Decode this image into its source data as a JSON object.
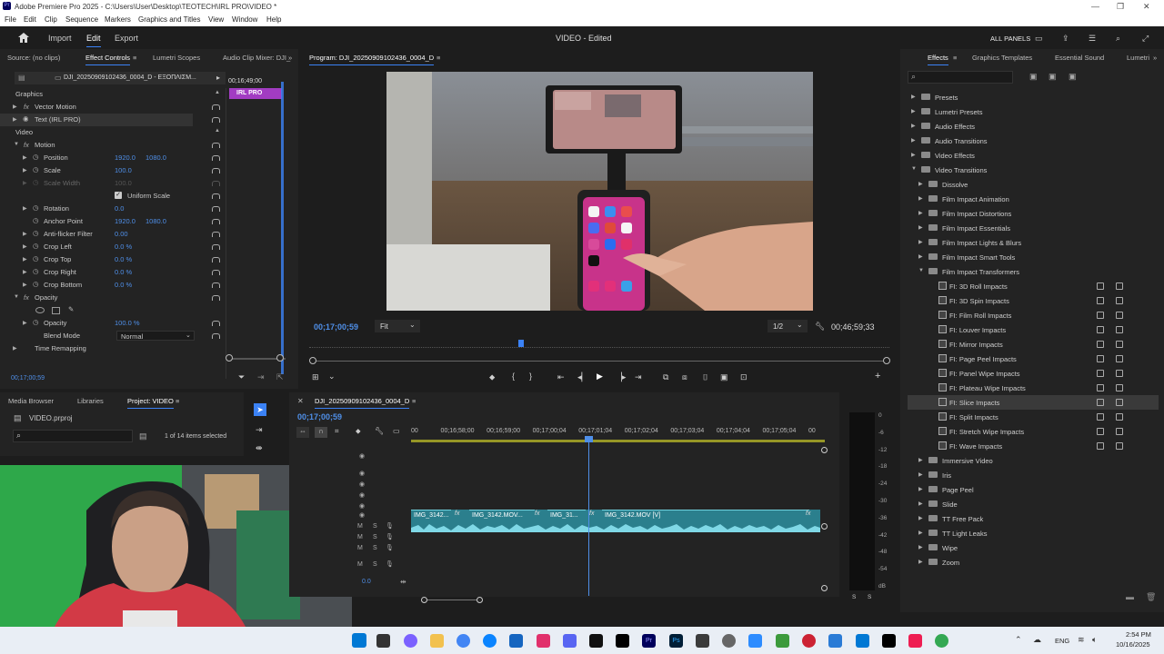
{
  "title_bar": {
    "title": "Adobe Premiere Pro 2025 - C:\\Users\\User\\Desktop\\TEOTECH\\IRL PRO\\VIDEO *",
    "app_icon": "Pr"
  },
  "menu": [
    "File",
    "Edit",
    "Clip",
    "Sequence",
    "Markers",
    "Graphics and Titles",
    "View",
    "Window",
    "Help"
  ],
  "top_bar": {
    "import": "Import",
    "edit": "Edit",
    "export": "Export",
    "project_title": "VIDEO - Edited",
    "all_panels": "ALL PANELS"
  },
  "source_panel": {
    "tabs": [
      "Source: (no clips)",
      "Effect Controls",
      "Lumetri Scopes",
      "Audio Clip Mixer: DJI_"
    ],
    "clip_name": "DJI_20250909102436_0004_D - ΕΞΟΠΛΙΣΜ...",
    "mini_timecode": "00;16;49;00",
    "graphic_clip": "IRL PRO",
    "section_graphics": "Graphics",
    "vector_motion": "Vector Motion",
    "text_layer": "Text (IRL PRO)",
    "section_video": "Video",
    "motion": "Motion",
    "position": {
      "label": "Position",
      "x": "1920.0",
      "y": "1080.0"
    },
    "scale": {
      "label": "Scale",
      "value": "100.0"
    },
    "scale_width": {
      "label": "Scale Width",
      "value": "100.0"
    },
    "uniform_scale": "Uniform Scale",
    "rotation": {
      "label": "Rotation",
      "value": "0.0"
    },
    "anchor_point": {
      "label": "Anchor Point",
      "x": "1920.0",
      "y": "1080.0"
    },
    "anti_flicker": {
      "label": "Anti-flicker Filter",
      "value": "0.00"
    },
    "crop_left": {
      "label": "Crop Left",
      "value": "0.0 %"
    },
    "crop_top": {
      "label": "Crop Top",
      "value": "0.0 %"
    },
    "crop_right": {
      "label": "Crop Right",
      "value": "0.0 %"
    },
    "crop_bottom": {
      "label": "Crop Bottom",
      "value": "0.0 %"
    },
    "opacity_section": "Opacity",
    "opacity": {
      "label": "Opacity",
      "value": "100.0 %"
    },
    "blend_mode": {
      "label": "Blend Mode",
      "value": "Normal"
    },
    "time_remapping": "Time Remapping",
    "footer_timecode": "00;17;00;59"
  },
  "program_panel": {
    "title": "Program: DJI_20250909102436_0004_D",
    "timecode": "00;17;00;59",
    "fit": "Fit",
    "resolution": "1/2",
    "duration": "00;46;59;33",
    "playhead_fraction": 0.36
  },
  "effects_panel": {
    "tabs": [
      "Effects",
      "Graphics Templates",
      "Essential Sound",
      "Lumetri"
    ],
    "tree": [
      {
        "label": "Presets",
        "level": 0,
        "kind": "folder"
      },
      {
        "label": "Lumetri Presets",
        "level": 0,
        "kind": "folder"
      },
      {
        "label": "Audio Effects",
        "level": 0,
        "kind": "folder"
      },
      {
        "label": "Audio Transitions",
        "level": 0,
        "kind": "folder"
      },
      {
        "label": "Video Effects",
        "level": 0,
        "kind": "folder"
      },
      {
        "label": "Video Transitions",
        "level": 0,
        "kind": "folder",
        "open": true
      },
      {
        "label": "Dissolve",
        "level": 1,
        "kind": "folder"
      },
      {
        "label": "Film Impact Animation",
        "level": 1,
        "kind": "folder"
      },
      {
        "label": "Film Impact Distortions",
        "level": 1,
        "kind": "folder"
      },
      {
        "label": "Film Impact Essentials",
        "level": 1,
        "kind": "folder"
      },
      {
        "label": "Film Impact Lights & Blurs",
        "level": 1,
        "kind": "folder"
      },
      {
        "label": "Film Impact Smart Tools",
        "level": 1,
        "kind": "folder"
      },
      {
        "label": "Film Impact Transformers",
        "level": 1,
        "kind": "folder",
        "open": true
      },
      {
        "label": "FI: 3D Roll Impacts",
        "level": 2,
        "kind": "item"
      },
      {
        "label": "FI: 3D Spin Impacts",
        "level": 2,
        "kind": "item"
      },
      {
        "label": "FI: Film Roll Impacts",
        "level": 2,
        "kind": "item"
      },
      {
        "label": "FI: Louver Impacts",
        "level": 2,
        "kind": "item"
      },
      {
        "label": "FI: Mirror Impacts",
        "level": 2,
        "kind": "item"
      },
      {
        "label": "FI: Page Peel Impacts",
        "level": 2,
        "kind": "item"
      },
      {
        "label": "FI: Panel Wipe Impacts",
        "level": 2,
        "kind": "item"
      },
      {
        "label": "FI: Plateau Wipe Impacts",
        "level": 2,
        "kind": "item"
      },
      {
        "label": "FI: Slice Impacts",
        "level": 2,
        "kind": "item",
        "selected": true
      },
      {
        "label": "FI: Split Impacts",
        "level": 2,
        "kind": "item"
      },
      {
        "label": "FI: Stretch Wipe Impacts",
        "level": 2,
        "kind": "item"
      },
      {
        "label": "FI: Wave Impacts",
        "level": 2,
        "kind": "item"
      },
      {
        "label": "Immersive Video",
        "level": 1,
        "kind": "folder"
      },
      {
        "label": "Iris",
        "level": 1,
        "kind": "folder"
      },
      {
        "label": "Page Peel",
        "level": 1,
        "kind": "folder"
      },
      {
        "label": "Slide",
        "level": 1,
        "kind": "folder"
      },
      {
        "label": "TT Free Pack",
        "level": 1,
        "kind": "folder"
      },
      {
        "label": "TT Light Leaks",
        "level": 1,
        "kind": "folder"
      },
      {
        "label": "Wipe",
        "level": 1,
        "kind": "folder"
      },
      {
        "label": "Zoom",
        "level": 1,
        "kind": "folder"
      }
    ]
  },
  "project_panel": {
    "tabs": [
      "Media Browser",
      "Libraries",
      "Project: VIDEO"
    ],
    "file": "VIDEO.prproj",
    "selection": "1 of 14 items selected"
  },
  "timeline": {
    "sequence": "DJI_20250909102436_0004_D",
    "timecode": "00;17;00;59",
    "ruler": [
      "00",
      "00;16;58;00",
      "00;16;59;00",
      "00;17;00;04",
      "00;17;01;04",
      "00;17;02;04",
      "00;17;03;04",
      "00;17;04;04",
      "00;17;05;04",
      "00"
    ],
    "clips": [
      {
        "label": "IMG_3142...",
        "fx": "fx"
      },
      {
        "label": "IMG_3142.MOV...",
        "fx": "fx"
      },
      {
        "label": "IMG_31...",
        "fx": "fx"
      },
      {
        "label": "IMG_3142.MOV [V]",
        "fx": "fx"
      }
    ],
    "audio_rows": [
      "M",
      "S",
      "M",
      "S",
      "M",
      "S",
      "M",
      "S"
    ],
    "level_value": "0.0"
  },
  "audio_meter": {
    "scale": [
      "0",
      "-6",
      "-12",
      "-18",
      "-24",
      "-30",
      "-36",
      "-42",
      "-48",
      "-54",
      "dB"
    ],
    "footer": [
      "S",
      "S"
    ]
  },
  "taskbar": {
    "lang": "ENG",
    "time": "2:54 PM",
    "date": "10/16/2025"
  },
  "colors": {
    "accent": "#3b82f6",
    "clip": "#2b7f8d",
    "graphic_clip": "#a23cc2",
    "timecode": "#4f8fe8"
  }
}
